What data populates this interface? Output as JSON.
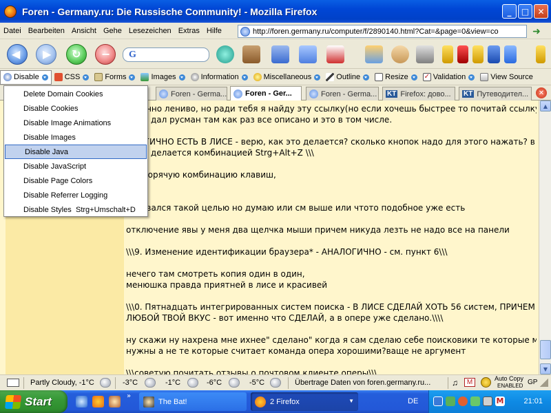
{
  "window": {
    "title": "Foren - Germany.ru: Die Russische Community! - Mozilla Firefox",
    "min": "_",
    "max": "□",
    "close": "✕"
  },
  "menubar": [
    "Datei",
    "Bearbeiten",
    "Ansicht",
    "Gehe",
    "Lesezeichen",
    "Extras",
    "Hilfe"
  ],
  "url": "http://foren.germany.ru/computer/f/2890140.html?Cat=&page=0&view=co",
  "search": {
    "engine_glyph": "G",
    "value": ""
  },
  "devtoolbar": [
    "Disable",
    "CSS",
    "Forms",
    "Images",
    "Information",
    "Miscellaneous",
    "Outline",
    "Resize",
    "Validation",
    "View Source"
  ],
  "tabs": [
    {
      "label": "Foren - Germa...",
      "selected": false
    },
    {
      "label": "Foren - Ger...",
      "selected": true
    },
    {
      "label": "Foren - Germa...",
      "selected": false
    },
    {
      "label": "Firefox: дово...",
      "selected": false,
      "badge": "KT"
    },
    {
      "label": "Путеводител...",
      "selected": false,
      "badge": "KT"
    }
  ],
  "disable_menu": {
    "items": [
      {
        "label": "Delete Domain Cookies",
        "shortcut": ""
      },
      {
        "label": "Disable Cookies",
        "shortcut": ""
      },
      {
        "label": "Disable Image Animations",
        "shortcut": ""
      },
      {
        "label": "Disable Images",
        "shortcut": ""
      },
      {
        "label": "Disable Java",
        "shortcut": "",
        "hover": true
      },
      {
        "label": "Disable JavaScript",
        "shortcut": ""
      },
      {
        "label": "Disable Page Colors",
        "shortcut": ""
      },
      {
        "label": "Disable Referrer Logging",
        "shortcut": ""
      },
      {
        "label": "Disable Styles",
        "shortcut": "Strg+Umschalt+D"
      }
    ]
  },
  "post_lines": [
    "конечно лениво, но ради тебя я найду эту ссылку(но если хочешь быстрее то почитай ссылку",
    "орую дал русман там как раз все описано и это в том числе.",
    "",
    "АЛОГИЧНО ЕСТЬ В ЛИСЕ - верю, как это делается? сколько кнопок надо для этого нажать? в",
    "е это делается комбинацией Strg+Alt+Z \\\\\\",
    "",
    "ачь горячую комбинацию клавиш,",
    "",
    "",
    "задавался такой целью но думаю или см выше или чтото подобное уже есть",
    "",
    "отключение явы у меня два щелчка мыши причем никуда лезть не надо все на панели",
    "",
    "\\\\\\9. Изменение идентификации браузера* - АНАЛОГИЧНО - см. пункт 6\\\\\\",
    "",
    "нечего там смотреть копия один в один,",
    "менюшка правда приятней в лисе и красивей",
    "",
    "\\\\\\0. Пятнадцать интегрированных систем поиска - В ЛИСЕ СДЕЛАЙ ХОТЬ 56 систем, ПРИЧЕМ НА",
    "ЛЮБОЙ ТВОЙ ВКУС - вот именно что СДЕЛАЙ, а в опере уже сделано.\\\\\\\\",
    "",
    "ну скажи ну нахрена мне ихнее\" сделано\" когда я сам сделаю себе поисковики те которые мне",
    "нужны а не те которые считает команда опера хорошими?ваще не аргумент",
    "",
    "\\\\\\советую почитать отзывы о почтовом клиенте оперы\\\\\\"
  ],
  "status": {
    "weather": "Partly Cloudy, -1°C",
    "forecast": [
      "-3°C",
      "-1°C",
      "-6°C",
      "-5°C"
    ],
    "message": "Übertrage Daten von foren.germany.ru...",
    "autocopy": "Auto Copy",
    "autocopy_state": "ENABLED",
    "gp": "GP"
  },
  "taskbar": {
    "start": "Start",
    "tasks": [
      {
        "label": "The Bat!"
      },
      {
        "label": "2 Firefox",
        "active": true
      }
    ],
    "lang": "DE",
    "clock": "21:01"
  }
}
